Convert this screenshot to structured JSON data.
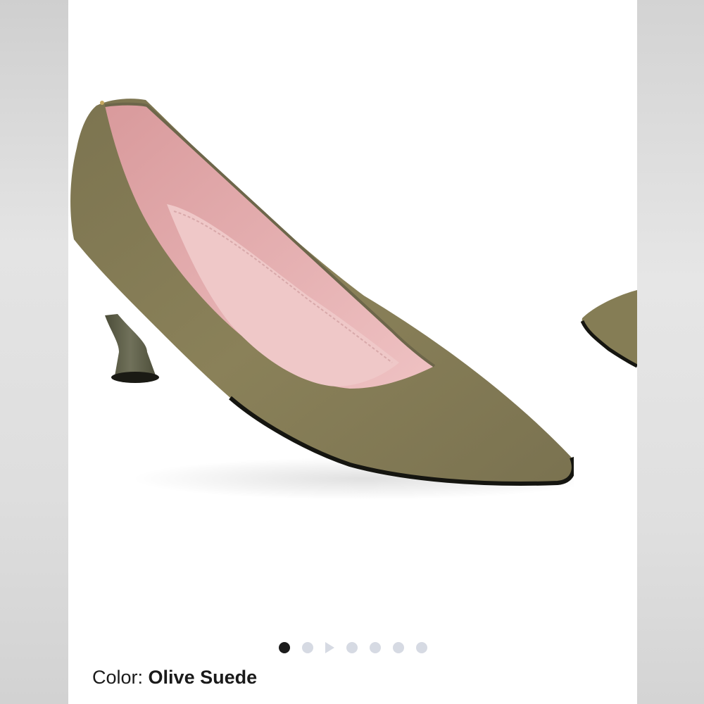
{
  "product": {
    "color_label": "Color:",
    "color_value": "Olive Suede",
    "image_description_icon": "olive-suede-pump-image"
  },
  "carousel": {
    "total_items": 7,
    "active_index": 0,
    "video_item_index": 2
  },
  "colors": {
    "suede": "#857d55",
    "lining": "#e8aeb0",
    "heel": "#5e5f47",
    "active_dot": "#1c1c1c",
    "inactive_dot": "#d6dae3"
  }
}
